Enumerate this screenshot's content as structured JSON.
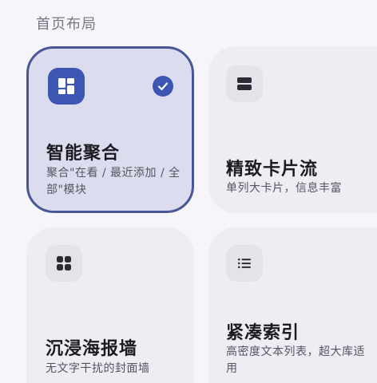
{
  "section": {
    "title": "首页布局"
  },
  "layouts": [
    {
      "title": "智能聚合",
      "desc": "聚合\"在看 / 最近添加 / 全部\"模块",
      "icon": "dashboard-grid-icon",
      "selected": true
    },
    {
      "title": "精致卡片流",
      "desc": "单列大卡片，信息丰富",
      "icon": "card-stack-icon",
      "selected": false
    },
    {
      "title": "沉浸海报墙",
      "desc": "无文字干扰的封面墙",
      "icon": "grid-four-icon",
      "selected": false
    },
    {
      "title": "紧凑索引",
      "desc": "高密度文本列表，超大库适用",
      "icon": "list-icon",
      "selected": false
    }
  ],
  "colors": {
    "accent": "#3e56b3",
    "selected_bg": "#dcdcef",
    "selected_border": "#4a5796",
    "card_bg": "#efedf4",
    "page_bg": "#f6f5f9"
  }
}
